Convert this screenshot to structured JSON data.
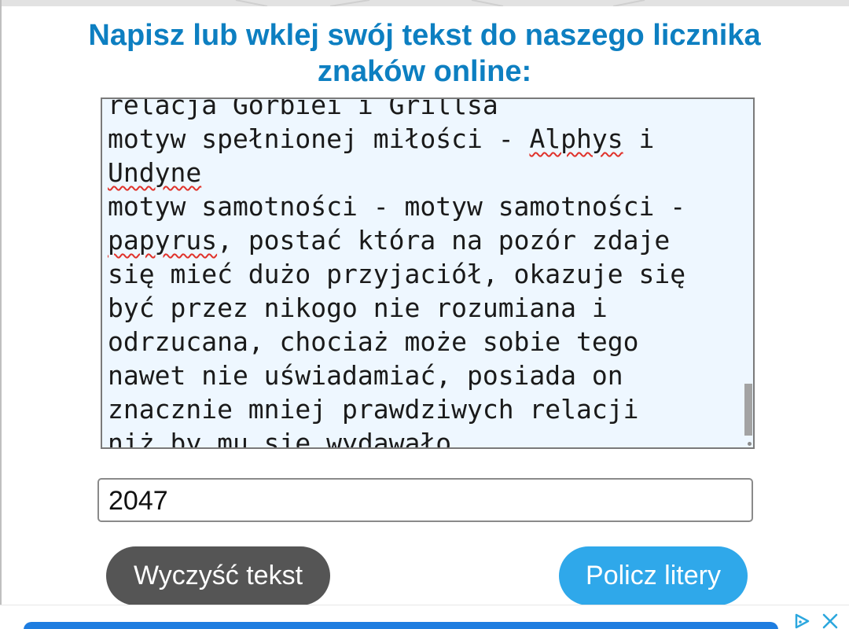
{
  "heading": {
    "line1": "Napisz lub wklej swój tekst do naszego licznika",
    "line2": "znaków online:"
  },
  "textarea": {
    "lines": [
      {
        "segments": [
          {
            "t": "relacja Gorbiei i Grillsa",
            "sp": false
          }
        ]
      },
      {
        "segments": [
          {
            "t": "motyw spełnionej miłości - ",
            "sp": false
          },
          {
            "t": "Alphys",
            "sp": true
          },
          {
            "t": " i",
            "sp": false
          }
        ]
      },
      {
        "segments": [
          {
            "t": "Undyne",
            "sp": true
          }
        ]
      },
      {
        "segments": [
          {
            "t": "motyw samotności - motyw samotności -",
            "sp": false
          }
        ]
      },
      {
        "segments": [
          {
            "t": "papyrus",
            "sp": true
          },
          {
            "t": ", postać która na pozór zdaje",
            "sp": false
          }
        ]
      },
      {
        "segments": [
          {
            "t": "się mieć dużo przyjaciół, okazuje się",
            "sp": false
          }
        ]
      },
      {
        "segments": [
          {
            "t": "być przez nikogo nie rozumiana i",
            "sp": false
          }
        ]
      },
      {
        "segments": [
          {
            "t": "odrzucana, chociaż może sobie tego",
            "sp": false
          }
        ]
      },
      {
        "segments": [
          {
            "t": "nawet nie uświadamiać, posiada on",
            "sp": false
          }
        ]
      },
      {
        "segments": [
          {
            "t": "znacznie mniej prawdziwych relacji",
            "sp": false
          }
        ]
      },
      {
        "segments": [
          {
            "t": "niż by mu się wydawało",
            "sp": false
          }
        ]
      }
    ]
  },
  "count_field": {
    "value": "2047"
  },
  "buttons": {
    "clear_label": "Wyczyść tekst",
    "count_label": "Policz litery"
  },
  "ad": {
    "choices_icon": "adchoices-icon",
    "close_icon": "close-icon"
  },
  "colors": {
    "heading": "#0d7fc1",
    "textarea_bg": "#eef7ff",
    "clear_button": "#555555",
    "count_button": "#2fa8ea",
    "spellcheck": "#e0322b"
  }
}
